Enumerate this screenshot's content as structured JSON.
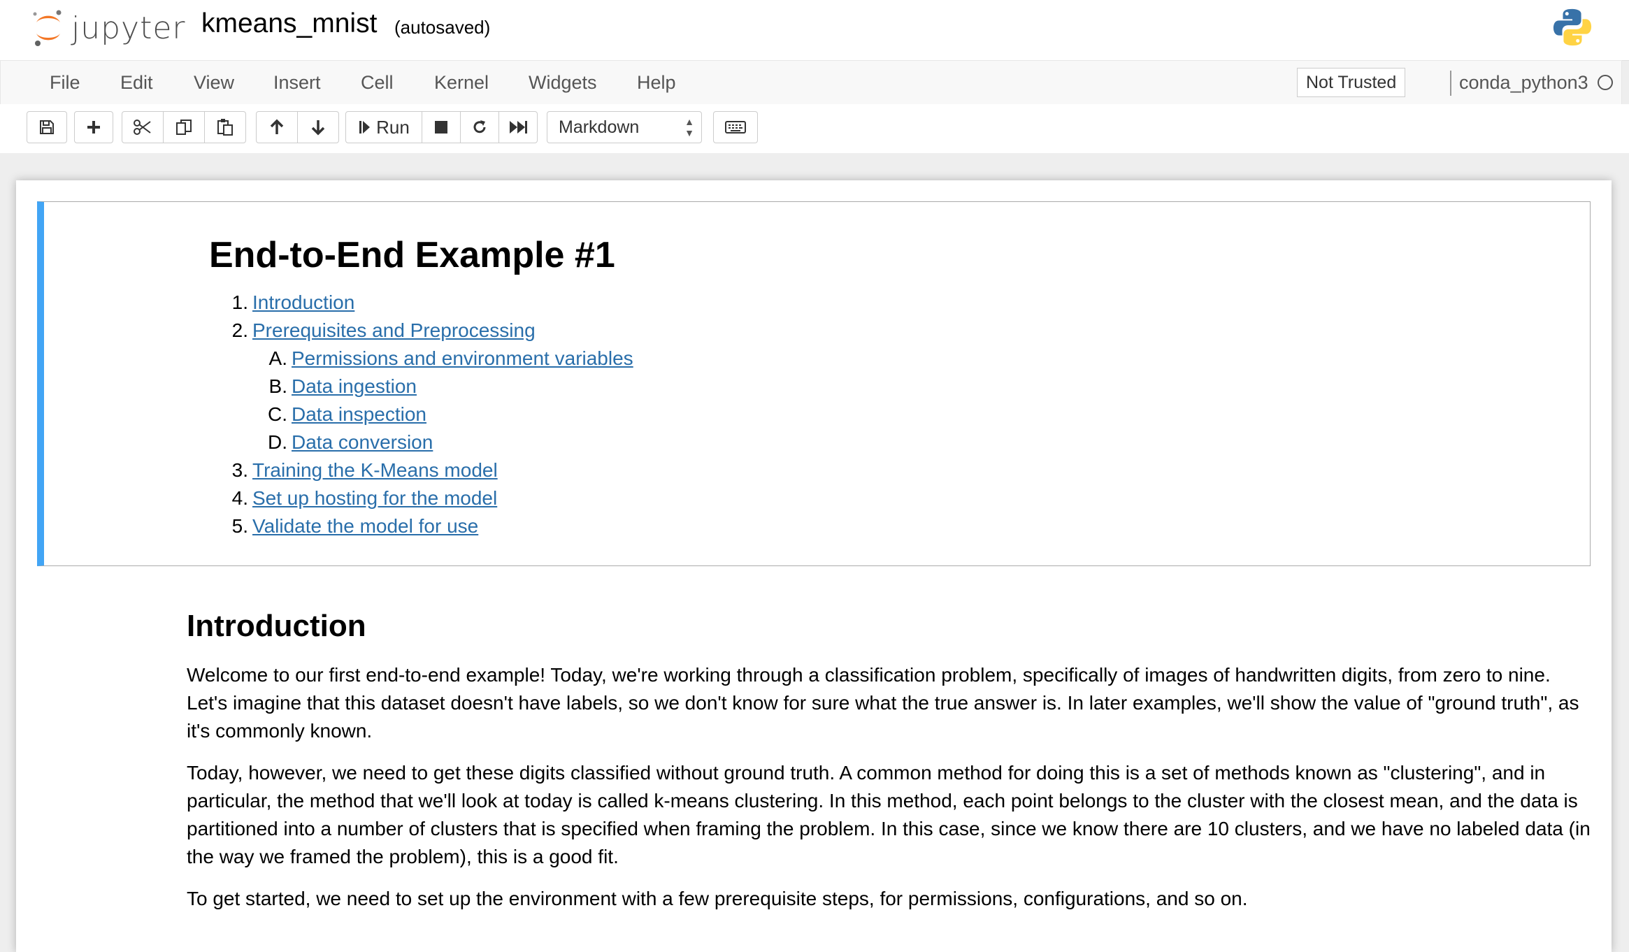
{
  "header": {
    "logo_text": "jupyter",
    "notebook_name": "kmeans_mnist",
    "autosave_status": "(autosaved)"
  },
  "menubar": {
    "items": [
      "File",
      "Edit",
      "View",
      "Insert",
      "Cell",
      "Kernel",
      "Widgets",
      "Help"
    ],
    "trust_status": "Not Trusted",
    "kernel_name": "conda_python3"
  },
  "toolbar": {
    "run_label": "Run",
    "cell_type": "Markdown",
    "icons": [
      "save-icon",
      "plus-icon",
      "cut-icon",
      "copy-icon",
      "paste-icon",
      "arrow-up-icon",
      "arrow-down-icon",
      "run-icon",
      "stop-icon",
      "restart-icon",
      "fast-forward-icon",
      "keyboard-icon"
    ]
  },
  "toc_cell": {
    "title": "End-to-End Example #1",
    "items": [
      {
        "num": "1.",
        "label": "Introduction"
      },
      {
        "num": "2.",
        "label": "Prerequisites and Preprocessing"
      },
      {
        "num": "A.",
        "label": "Permissions and environment variables"
      },
      {
        "num": "B.",
        "label": "Data ingestion"
      },
      {
        "num": "C.",
        "label": "Data inspection"
      },
      {
        "num": "D.",
        "label": "Data conversion"
      },
      {
        "num": "3.",
        "label": "Training the K-Means model"
      },
      {
        "num": "4.",
        "label": "Set up hosting for the model"
      },
      {
        "num": "5.",
        "label": "Validate the model for use"
      }
    ]
  },
  "intro_cell": {
    "heading": "Introduction",
    "paragraphs": [
      "Welcome to our first end-to-end example! Today, we're working through a classification problem, specifically of images of handwritten digits, from zero to nine. Let's imagine that this dataset doesn't have labels, so we don't know for sure what the true answer is. In later examples, we'll show the value of \"ground truth\", as it's commonly known.",
      "Today, however, we need to get these digits classified without ground truth. A common method for doing this is a set of methods known as \"clustering\", and in particular, the method that we'll look at today is called k-means clustering. In this method, each point belongs to the cluster with the closest mean, and the data is partitioned into a number of clusters that is specified when framing the problem. In this case, since we know there are 10 clusters, and we have no labeled data (in the way we framed the problem), this is a good fit.",
      "To get started, we need to set up the environment with a few prerequisite steps, for permissions, configurations, and so on."
    ]
  }
}
